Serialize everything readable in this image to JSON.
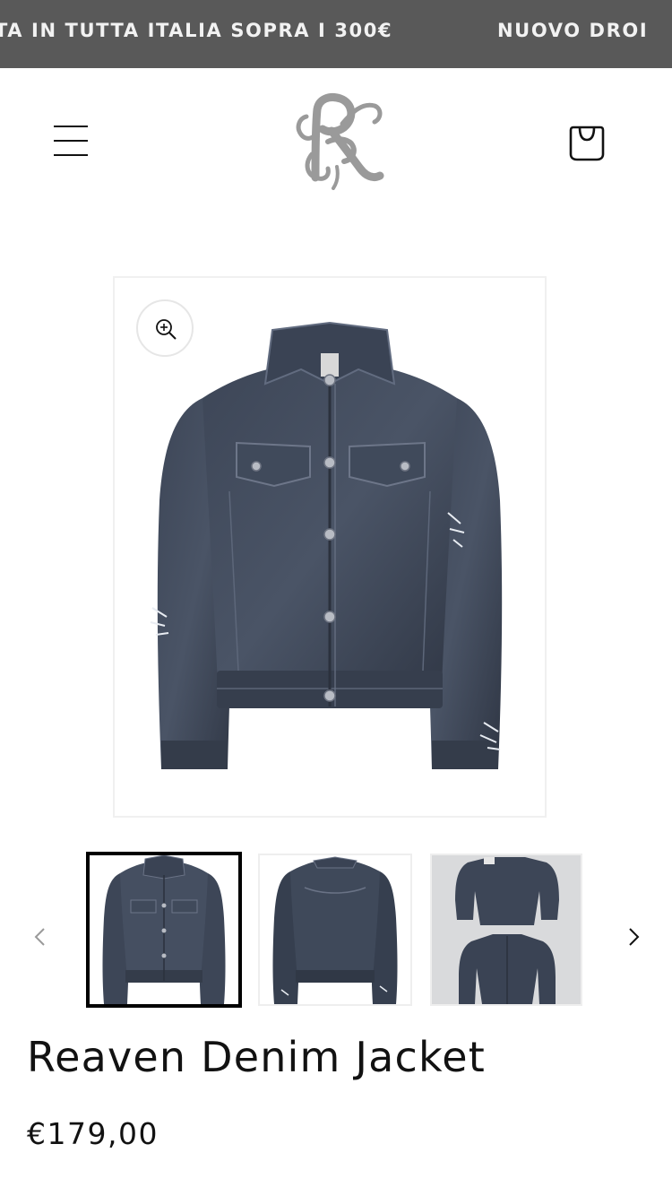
{
  "announcement": {
    "text_1": "TA IN TUTTA ITALIA SOPRA I 300€",
    "text_2": "NUOVO DROI"
  },
  "header": {
    "menu_icon": "hamburger-menu-icon",
    "logo_icon": "brand-monogram-rk-logo",
    "cart_icon": "shopping-bag-icon"
  },
  "gallery": {
    "zoom_icon": "zoom-in-icon",
    "prev_icon": "chevron-left-icon",
    "next_icon": "chevron-right-icon",
    "selected_thumbnail": 1,
    "thumbnails": [
      "front view",
      "back view",
      "flat lay two jackets"
    ]
  },
  "product": {
    "title": "Reaven Denim Jacket",
    "price": "€179,00"
  },
  "colors": {
    "announcement_bg": "#595959",
    "announcement_text": "#f2f2f2",
    "denim": "#3a4352",
    "text": "#121212"
  }
}
